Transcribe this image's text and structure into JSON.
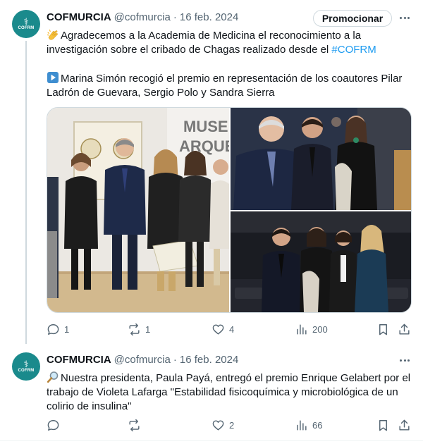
{
  "tweets": [
    {
      "avatar_text": "COFRM",
      "author_name": "COFMURCIA",
      "author_handle": "@cofmurcia",
      "separator": "·",
      "date": "16 feb. 2024",
      "promote_label": "Promocionar",
      "emoji_1": "clapping-hands",
      "text_1": "Agradecemos a la Academia de Medicina el reconocimiento a la investigación sobre el cribado de Chagas realizado desde el ",
      "hashtag": "#COFRM",
      "emoji_2": "play-button",
      "text_2": "Marina Simón recogió el premio en representación de los coautores Pilar Ladrón de Guevara, Sergio Polo y Sandra Sierra",
      "photo_sign_1": "MUSE",
      "photo_sign_2": "ARQUE",
      "replies": "1",
      "reposts": "1",
      "likes": "4",
      "views": "200"
    },
    {
      "avatar_text": "COFRM",
      "author_name": "COFMURCIA",
      "author_handle": "@cofmurcia",
      "separator": "·",
      "date": "16 feb. 2024",
      "emoji": "magnifying-glass",
      "text": "Nuestra presidenta, Paula Payá, entregó el premio Enrique Gelabert por el trabajo de Violeta Lafarga \"Estabilidad fisicoquímica y microbiológica de un colirio de insulina\"",
      "replies": "",
      "reposts": "",
      "likes": "2",
      "views": "66"
    }
  ],
  "colors": {
    "accent": "#1d9bf0",
    "avatar_bg": "#1a8a8c",
    "secondary_text": "#536471",
    "border": "#cfd9de"
  },
  "icons": [
    "reply-icon",
    "repost-icon",
    "like-icon",
    "views-icon",
    "bookmark-icon",
    "share-icon",
    "more-icon"
  ]
}
